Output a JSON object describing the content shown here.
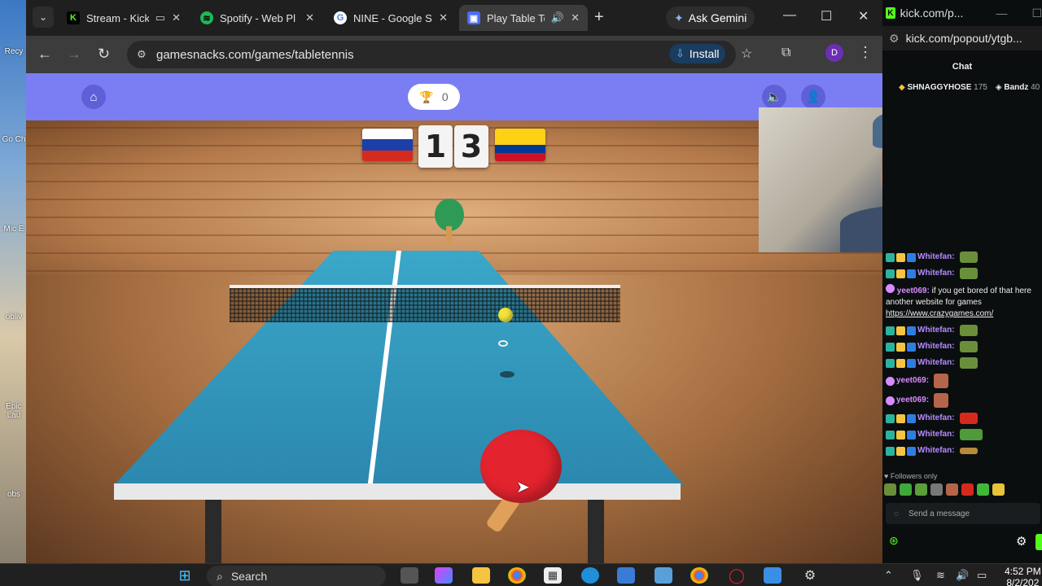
{
  "desktop": {
    "icons": [
      "Recy",
      "Go Ch",
      "Mic E",
      "obliv",
      "Epic Lau",
      "obs"
    ]
  },
  "tabs": [
    {
      "title": "Stream - Kick",
      "favicon": "kick-icon",
      "color": "#53fc18",
      "glyph": "K"
    },
    {
      "title": "Spotify - Web Pl",
      "favicon": "spotify-icon",
      "color": "#1db954",
      "glyph": "♪"
    },
    {
      "title": "NINE - Google S",
      "favicon": "google-icon",
      "color": "#ffffff",
      "glyph": "G"
    },
    {
      "title": "Play Table Te",
      "favicon": "gamesnacks-icon",
      "color": "#4a6cf7",
      "glyph": "▣"
    }
  ],
  "toolbar": {
    "ask_gemini": "Ask Gemini",
    "url": "gamesnacks.com/games/tabletennis",
    "install": "Install",
    "profile_initial": "D"
  },
  "game": {
    "trophy_score": "0",
    "score_left": "1",
    "score_right": "3"
  },
  "chat_window": {
    "url": "kick.com/popout/ytgb...",
    "url_short": "kick.com/p...",
    "header": "Chat",
    "leaderboard": [
      {
        "name": "SHNAGGYHOSE",
        "points": "175"
      },
      {
        "name": "Bandz",
        "points": "40"
      }
    ],
    "messages": [
      {
        "user": "Whitefan:",
        "color": "#b48cff",
        "emote_color": "#6a8f3a"
      },
      {
        "user": "Whitefan:",
        "color": "#b48cff",
        "emote_color": "#6a8f3a"
      },
      {
        "user": "Whitefan:",
        "color": "#b48cff",
        "emote_color": "#6a8f3a"
      },
      {
        "user": "Whitefan:",
        "color": "#b48cff",
        "emote_color": "#6a8f3a"
      },
      {
        "user": "Whitefan:",
        "color": "#b48cff",
        "emote_color": "#6a8f3a"
      },
      {
        "user": "yeet069:",
        "color": "#d98cff",
        "emote_color": "#b5654a"
      },
      {
        "user": "yeet069:",
        "color": "#d98cff",
        "emote_color": "#b5654a"
      },
      {
        "user": "Whitefan:",
        "color": "#b48cff",
        "emote_color": "#d42a1e"
      },
      {
        "user": "Whitefan:",
        "color": "#b48cff",
        "emote_color": "#4f9a3a"
      },
      {
        "user": "Whitefan:",
        "color": "#b48cff",
        "emote_color": "#b58a3a"
      }
    ],
    "long_message": {
      "user": "yeet069:",
      "text": "if you get bored of that here another website for games",
      "link": "https://www.crazygames.com/"
    },
    "followers_only": "Followers only",
    "send_placeholder": "Send a message"
  },
  "taskbar": {
    "search": "Search",
    "time": "4:52 PM",
    "date": "8/2/202"
  },
  "colors": {
    "kick_green": "#53fc18",
    "game_header": "#7b7ef2",
    "install_blue": "#8ab4f8"
  }
}
